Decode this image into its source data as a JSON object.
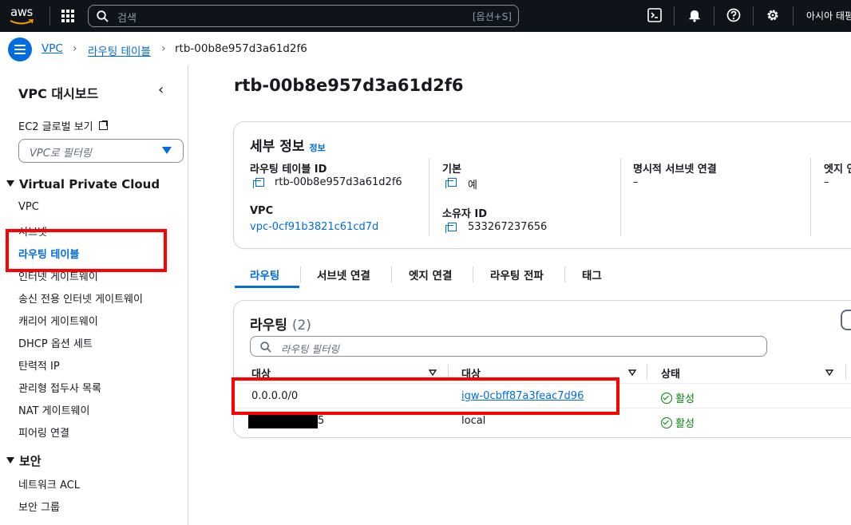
{
  "topbar": {
    "logo_text": "aws",
    "search_placeholder": "검색",
    "search_shortcut": "[옵션+S]",
    "region": "아시아 태평"
  },
  "breadcrumb": {
    "items": [
      "VPC",
      "라우팅 테이블"
    ],
    "current": "rtb-00b8e957d3a61d2f6"
  },
  "sidebar": {
    "title": "VPC 대시보드",
    "ec2_global": "EC2 글로벌 보기",
    "filter_placeholder": "VPC로 필터링",
    "section1": "Virtual Private Cloud",
    "items1": [
      "VPC",
      "서브넷",
      "라우팅 테이블",
      "인터넷 게이트웨이",
      "송신 전용 인터넷 게이트웨이",
      "캐리어 게이트웨이",
      "DHCP 옵션 세트",
      "탄력적 IP",
      "관리형 접두사 목록",
      "NAT 게이트웨이",
      "피어링 연결"
    ],
    "section2": "보안",
    "items2": [
      "네트워크 ACL",
      "보안 그룹"
    ]
  },
  "main": {
    "title": "rtb-00b8e957d3a61d2f6",
    "details": {
      "header": "세부 정보",
      "info": "정보",
      "rt_id_label": "라우팅 테이블 ID",
      "rt_id_value": "rtb-00b8e957d3a61d2f6",
      "vpc_label": "VPC",
      "vpc_value": "vpc-0cf91b3821c61cd7d",
      "main_label": "기본",
      "main_value": "예",
      "owner_label": "소유자 ID",
      "owner_value": "533267237656",
      "explicit_label": "명시적 서브넷 연결",
      "explicit_value": "–",
      "edge_label": "엣지 연",
      "edge_value": "–"
    },
    "tabs": [
      "라우팅",
      "서브넷 연결",
      "엣지 연결",
      "라우팅 전파",
      "태그"
    ],
    "routes": {
      "header": "라우팅",
      "count": "(2)",
      "filter_placeholder": "라우팅 필터링",
      "columns": [
        "대상",
        "대상",
        "상태"
      ],
      "rows": [
        {
          "destination": "0.0.0.0/0",
          "target": "igw-0cbff87a3feac7d96",
          "status": "활성"
        },
        {
          "destination": "5",
          "target": "local",
          "status": "활성"
        }
      ]
    }
  },
  "colors": {
    "accent": "#006ce0",
    "success": "#037f0c",
    "highlight": "#ff0000",
    "topbar": "#0f141a"
  }
}
